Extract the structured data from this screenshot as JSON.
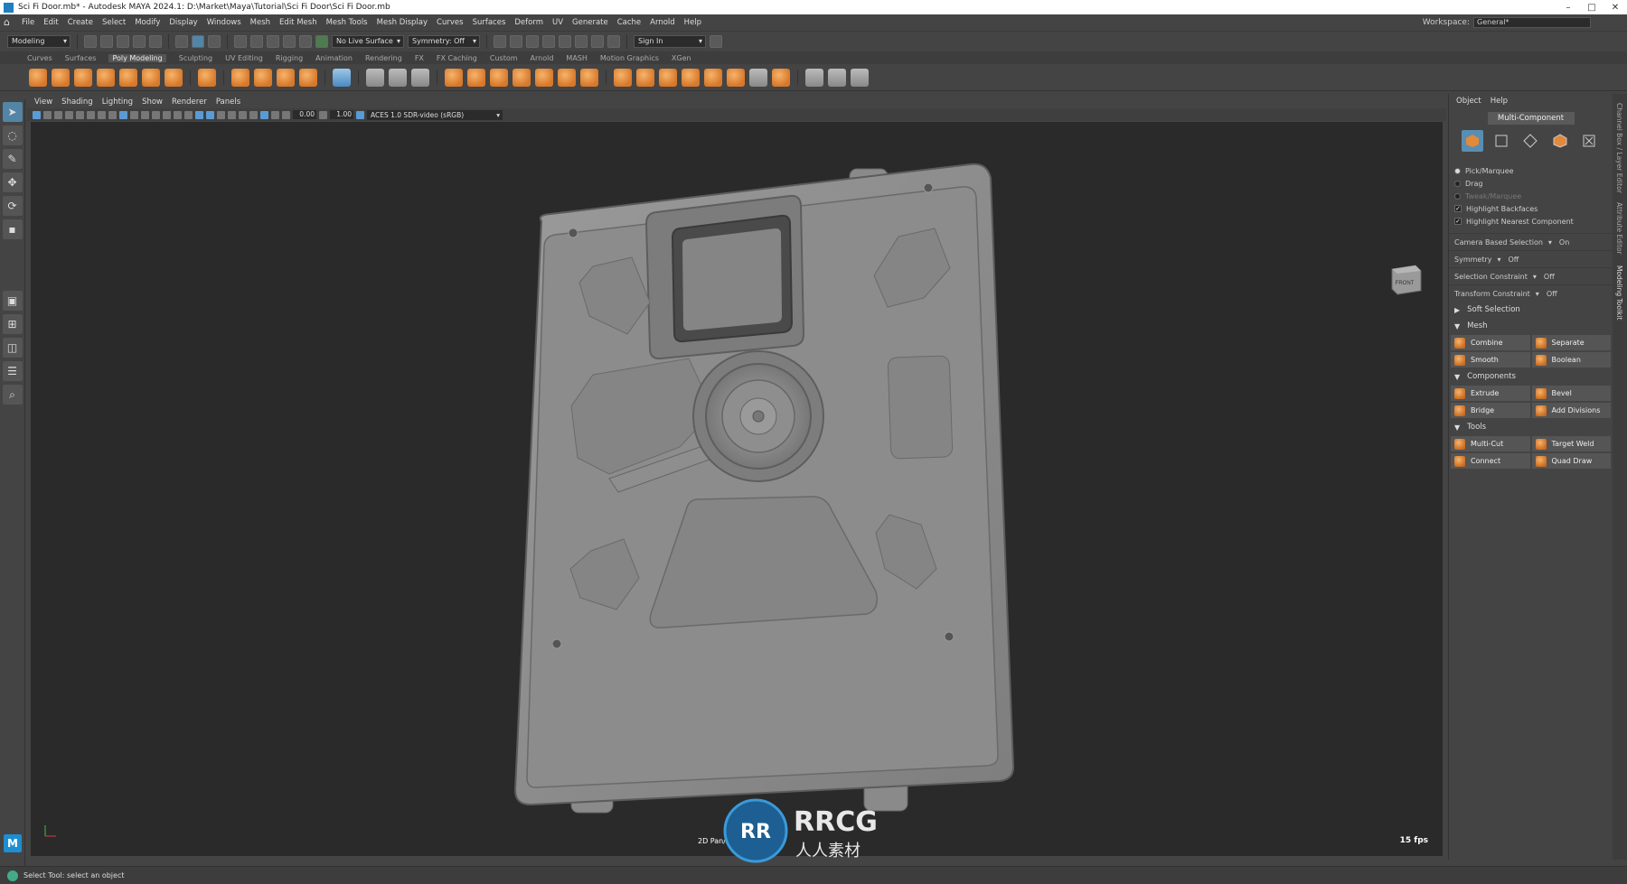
{
  "window": {
    "title": "Sci Fi Door.mb* - Autodesk MAYA 2024.1: D:\\Market\\Maya\\Tutorial\\Sci Fi Door\\Sci Fi Door.mb"
  },
  "menu": [
    "File",
    "Edit",
    "Create",
    "Select",
    "Modify",
    "Display",
    "Windows",
    "Mesh",
    "Edit Mesh",
    "Mesh Tools",
    "Mesh Display",
    "Curves",
    "Surfaces",
    "Deform",
    "UV",
    "Generate",
    "Cache",
    "Arnold",
    "Help"
  ],
  "workspace": {
    "label": "Workspace:",
    "value": "General*"
  },
  "status_line": {
    "menuset": "Modeling",
    "live_surface": "No Live Surface",
    "symmetry": "Symmetry: Off",
    "sign_in": "Sign In"
  },
  "shelf_tabs": [
    "Curves",
    "Surfaces",
    "Poly Modeling",
    "Sculpting",
    "UV Editing",
    "Rigging",
    "Animation",
    "Rendering",
    "FX",
    "FX Caching",
    "Custom",
    "Arnold",
    "MASH",
    "Motion Graphics",
    "XGen"
  ],
  "shelf_active_tab": "Poly Modeling",
  "viewport": {
    "menu": [
      "View",
      "Shading",
      "Lighting",
      "Show",
      "Renderer",
      "Panels"
    ],
    "exposure": "0.00",
    "gamma": "1.00",
    "color_space": "ACES 1.0 SDR-video (sRGB)",
    "viewcube_label": "FRONT",
    "camera_label": "2D Pan/Z",
    "fps": "15 fps"
  },
  "watermark": {
    "brand": "RRCG",
    "sub": "人人素材"
  },
  "toolkit": {
    "tabs": [
      "Object",
      "Help"
    ],
    "mode": "Multi-Component",
    "pick_options": [
      {
        "label": "Pick/Marquee",
        "on": true
      },
      {
        "label": "Drag",
        "on": false
      },
      {
        "label": "Tweak/Marquee",
        "on": false
      }
    ],
    "checks": [
      {
        "label": "Highlight Backfaces",
        "on": true
      },
      {
        "label": "Highlight Nearest Component",
        "on": true
      }
    ],
    "options": [
      {
        "label": "Camera Based Selection",
        "value": "On"
      },
      {
        "label": "Symmetry",
        "value": "Off"
      },
      {
        "label": "Selection Constraint",
        "value": "Off"
      },
      {
        "label": "Transform Constraint",
        "value": "Off"
      }
    ],
    "soft_selection": "Soft Selection",
    "sections": [
      {
        "title": "Mesh",
        "buttons": [
          "Combine",
          "Separate",
          "Smooth",
          "Boolean"
        ]
      },
      {
        "title": "Components",
        "buttons": [
          "Extrude",
          "Bevel",
          "Bridge",
          "Add Divisions"
        ]
      },
      {
        "title": "Tools",
        "buttons": [
          "Multi-Cut",
          "Target Weld",
          "Connect",
          "Quad Draw"
        ]
      }
    ]
  },
  "side_tabs": [
    "Channel Box / Layer Editor",
    "Attribute Editor",
    "Modeling Toolkit"
  ],
  "help_line": "Select Tool: select an object",
  "colors": {
    "accent": "#5285a6",
    "mesh": "#8c8c8c",
    "viewport_bg": "#2a2a2a",
    "icon_orange": "#e08a3c"
  }
}
